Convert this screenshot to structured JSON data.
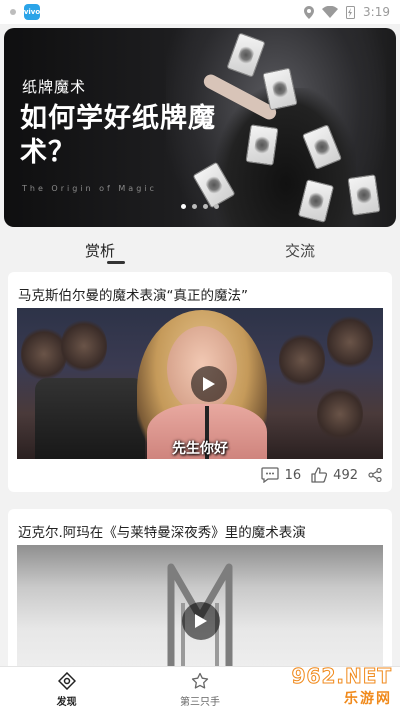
{
  "status_bar": {
    "time": "3:19",
    "app_badge": "vivo"
  },
  "banner": {
    "subtitle": "纸牌魔术",
    "title": "如何学好纸牌魔术？",
    "caption": "The Origin of Magic",
    "page_count": 4,
    "active_page": 1
  },
  "tabs": [
    {
      "label": "赏析",
      "active": true
    },
    {
      "label": "交流",
      "active": false
    }
  ],
  "videos": [
    {
      "title": "马克斯伯尔曼的魔术表演“真正的魔法”",
      "subtitle": "先生你好",
      "comments": "16",
      "likes": "492"
    },
    {
      "title": "迈克尔.阿玛在《与莱特曼深夜秀》里的魔术表演"
    }
  ],
  "bottom_nav": [
    {
      "label": "发现",
      "icon": "compass-icon",
      "active": true
    },
    {
      "label": "第三只手",
      "icon": "star-icon",
      "active": false
    }
  ],
  "watermark": {
    "line1": "962.NET",
    "line2": "乐游网"
  },
  "colors": {
    "accent": "#222222",
    "watermark": "#f08a1c",
    "badge": "#2ba4e8"
  }
}
